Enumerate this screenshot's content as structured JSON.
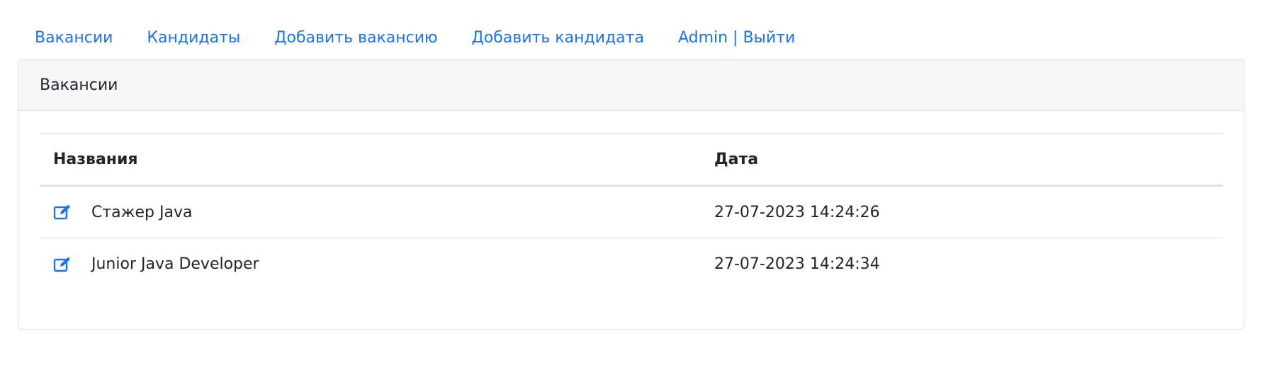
{
  "nav": {
    "items": [
      {
        "label": "Вакансии"
      },
      {
        "label": "Кандидаты"
      },
      {
        "label": "Добавить вакансию"
      },
      {
        "label": "Добавить кандидата"
      },
      {
        "label": "Admin | Выйти"
      }
    ]
  },
  "card": {
    "title": "Вакансии"
  },
  "table": {
    "headers": {
      "name": "Названия",
      "date": "Дата"
    },
    "rows": [
      {
        "name": "Стажер Java",
        "date": "27-07-2023 14:24:26",
        "icon": "edit-icon"
      },
      {
        "name": "Junior Java Developer",
        "date": "27-07-2023 14:24:34",
        "icon": "edit-icon"
      }
    ]
  },
  "colors": {
    "link": "#1a73e8",
    "header_bg": "#f7f7f7",
    "border": "#dee2e6"
  }
}
